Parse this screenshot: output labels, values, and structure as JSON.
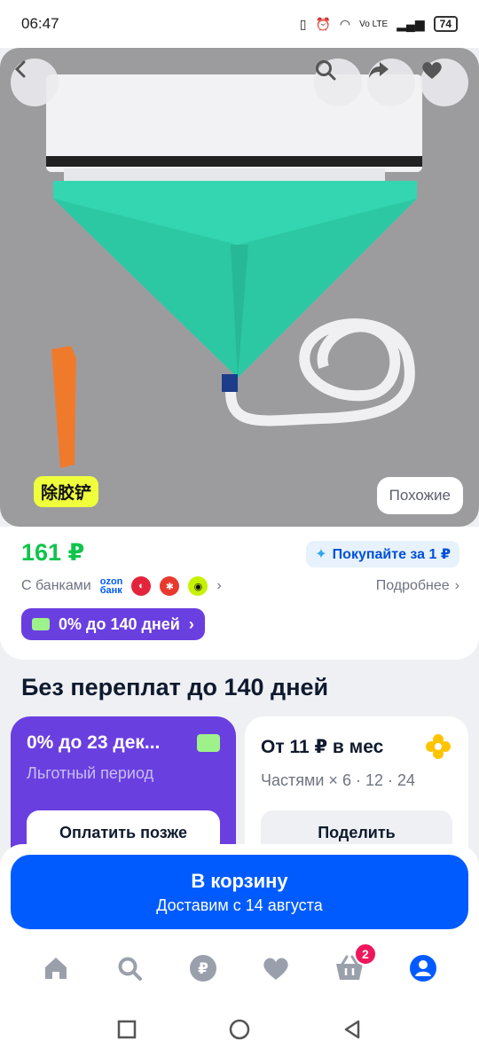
{
  "status_bar": {
    "time": "06:47",
    "network": "Vo LTE",
    "battery": "74"
  },
  "product": {
    "image_sticker": "除胶铲",
    "similar_label": "Похожие"
  },
  "price": {
    "value": "161 ₽",
    "buy_for_label": "Покупайте за 1 ₽",
    "banks_label": "С банками",
    "ozon_bank": [
      "ozon",
      "банк"
    ],
    "more_label": "Подробнее",
    "installment_pill": "0% до 140 дней"
  },
  "no_overpay": {
    "title": "Без переплат до 140 дней",
    "cards": [
      {
        "title": "0% до 23 дек...",
        "subtitle": "Льготный период",
        "button": "Оплатить позже"
      },
      {
        "title": "От 11 ₽ в мес",
        "subtitle": "Частями × 6 · 12 · 24",
        "button": "Поделить"
      }
    ]
  },
  "cart": {
    "title": "В корзину",
    "subtitle": "Доставим с 14 августа"
  },
  "tabbar": {
    "items": [
      {
        "icon": "home-icon"
      },
      {
        "icon": "search-icon"
      },
      {
        "icon": "ruble-icon"
      },
      {
        "icon": "heart-icon"
      },
      {
        "icon": "basket-icon",
        "badge": "2"
      },
      {
        "icon": "profile-icon"
      }
    ]
  },
  "colors": {
    "accent": "#005bff",
    "price": "#10c44c",
    "purple": "#6a3fe0",
    "badge": "#f0165c"
  }
}
